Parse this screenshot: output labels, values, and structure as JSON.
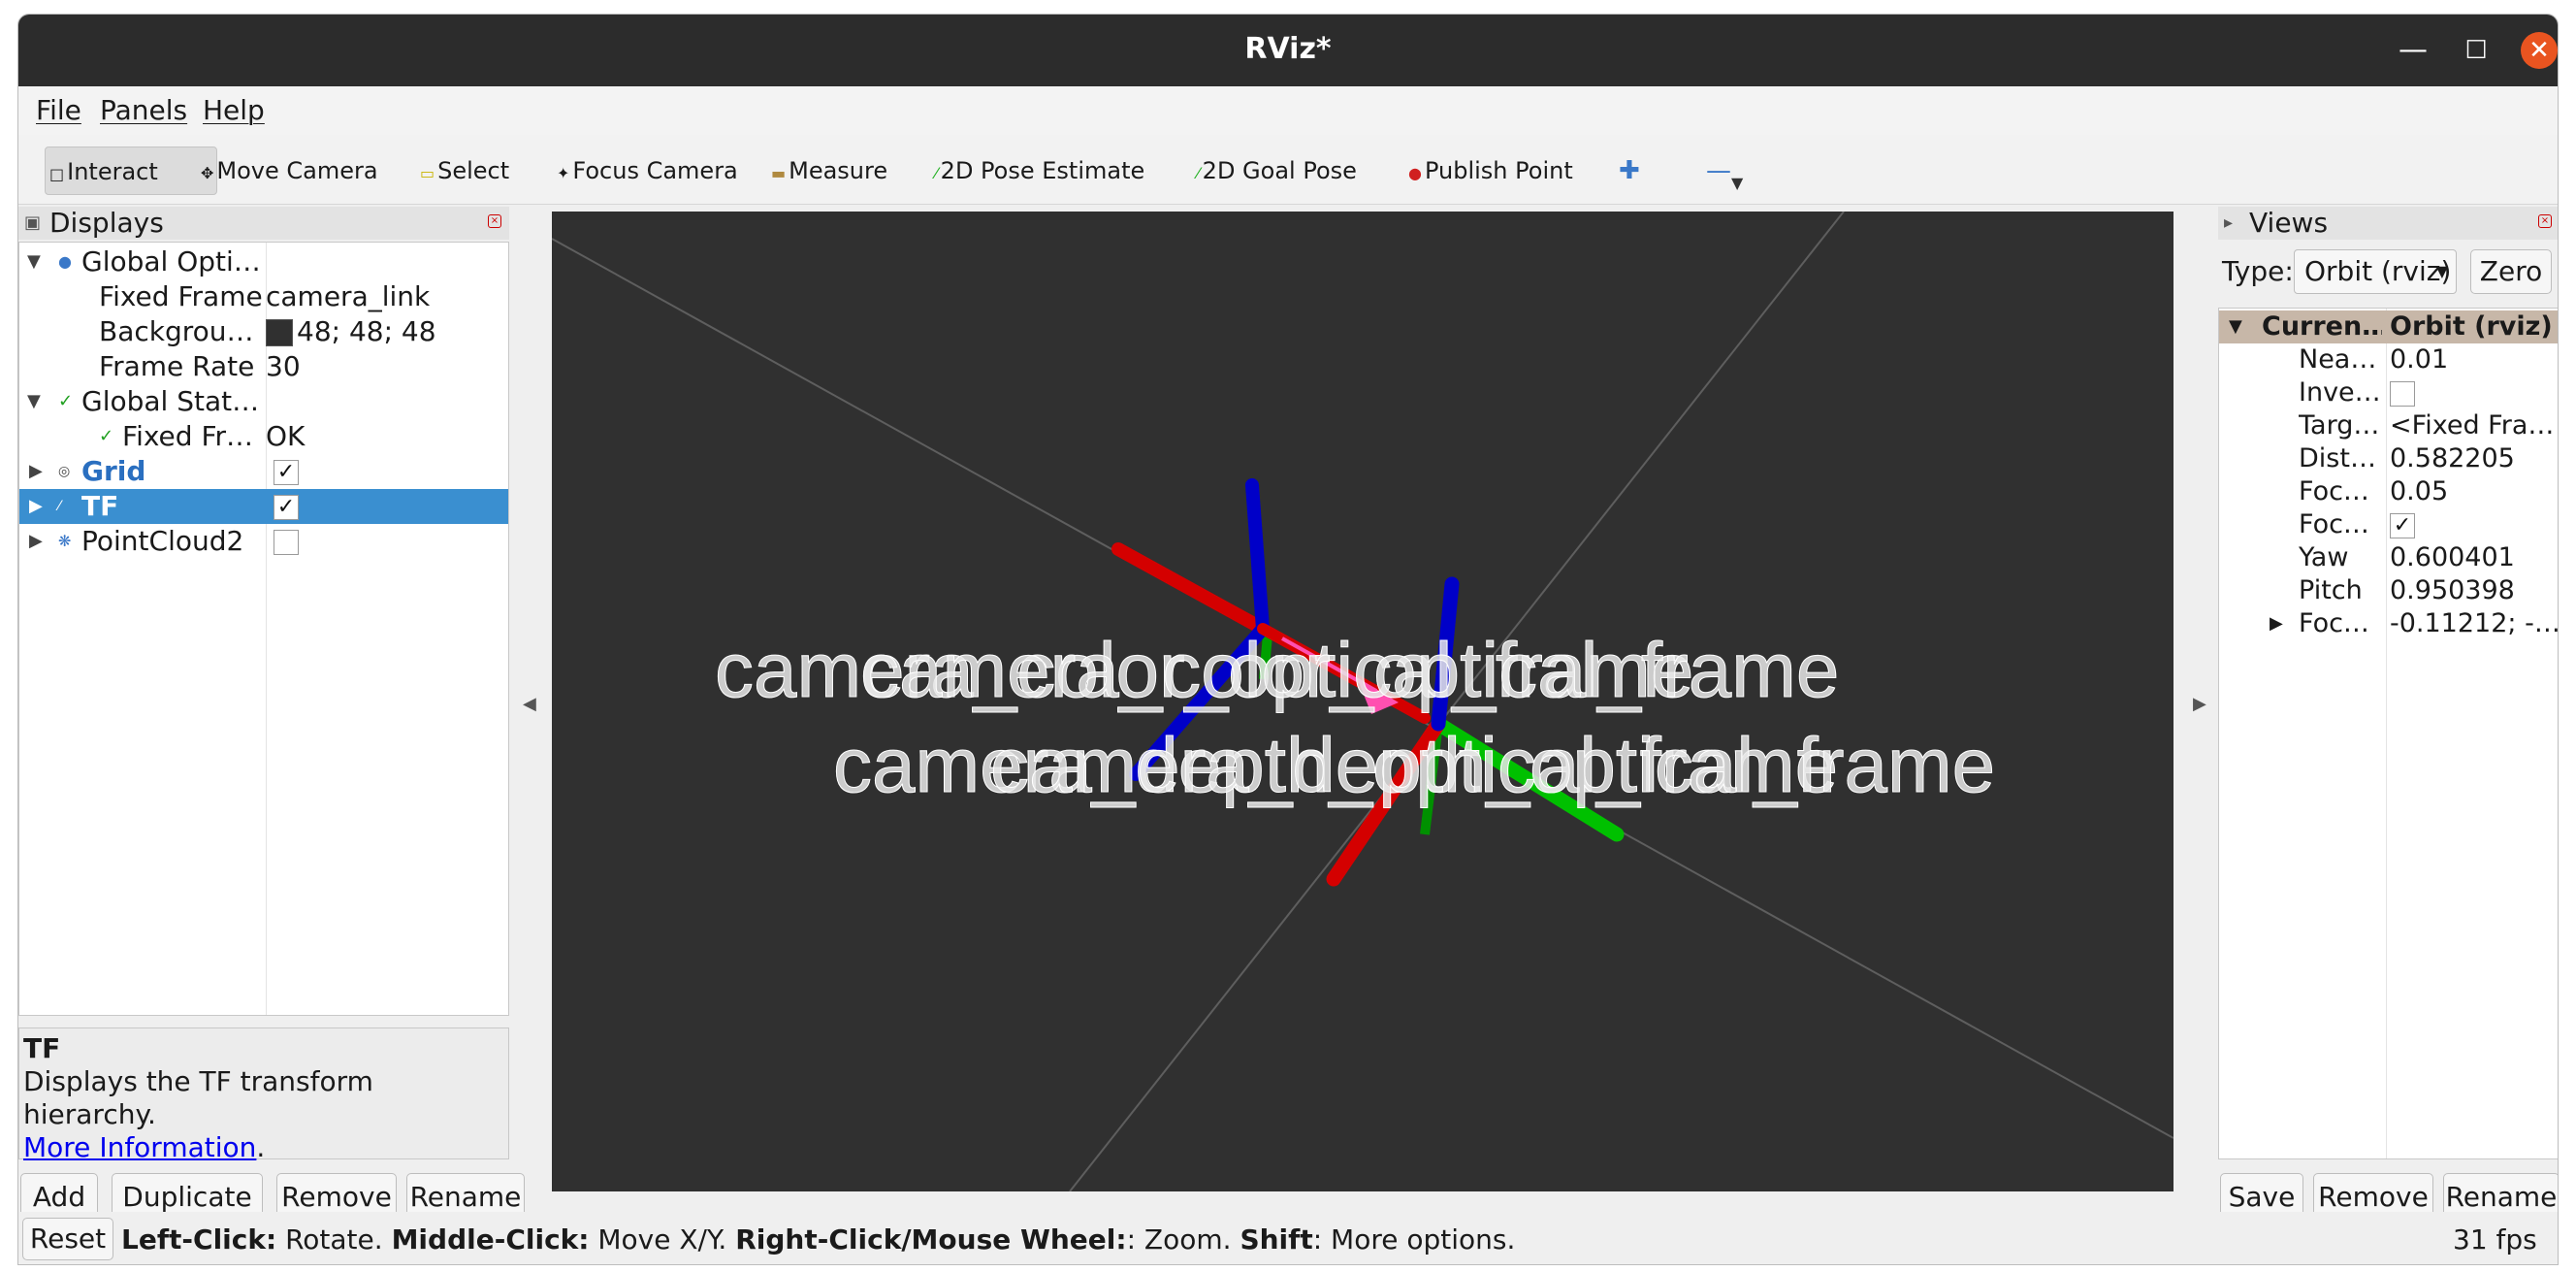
{
  "window": {
    "title": "RViz*"
  },
  "menu": {
    "file": "File",
    "panels": "Panels",
    "help": "Help"
  },
  "toolbar": {
    "interact": "Interact",
    "move_camera": "Move Camera",
    "select": "Select",
    "focus_camera": "Focus Camera",
    "measure": "Measure",
    "pose_estimate": "2D Pose Estimate",
    "goal_pose": "2D Goal Pose",
    "publish_point": "Publish Point"
  },
  "displays": {
    "title": "Displays",
    "rows": {
      "global_options": "Global Opti…",
      "fixed_frame_key": "Fixed Frame",
      "fixed_frame_val": "camera_link",
      "background_key": "Backgrou…",
      "background_val": "48; 48; 48",
      "frame_rate_key": "Frame Rate",
      "frame_rate_val": "30",
      "global_status": "Global Stat…",
      "fixed_frame_status_key": "Fixed Fr…",
      "fixed_frame_status_val": "OK",
      "grid": "Grid",
      "tf": "TF",
      "pointcloud": "PointCloud2"
    },
    "checks": {
      "grid": true,
      "tf": true,
      "pointcloud": false
    },
    "background_color": "#303030",
    "description": {
      "title": "TF",
      "text": "Displays the TF transform hierarchy.",
      "link": "More Information",
      "suffix": "."
    },
    "buttons": {
      "add": "Add",
      "duplicate": "Duplicate",
      "remove": "Remove",
      "rename": "Rename"
    }
  },
  "viewport": {
    "frame_labels": {
      "row1": "camera_color_optical_frame",
      "row2": "camera_depth_optical_frame"
    },
    "colors": {
      "x_axis": "#d40000",
      "y_axis": "#00c000",
      "z_axis": "#0000c8",
      "arrow": "#ff50b0",
      "background": "#303030"
    }
  },
  "views": {
    "title": "Views",
    "type_label": "Type:",
    "type_value": "Orbit (rviz)",
    "zero": "Zero",
    "header_key": "Curren…",
    "header_val": "Orbit (rviz)",
    "props": [
      {
        "key": "Nea…",
        "val": "0.01"
      },
      {
        "key": "Inve…",
        "val": ""
      },
      {
        "key": "Targ…",
        "val": "<Fixed Fra…"
      },
      {
        "key": "Dist…",
        "val": "0.582205"
      },
      {
        "key": "Foc…",
        "val": "0.05"
      },
      {
        "key": "Foc…",
        "val": ""
      },
      {
        "key": "Yaw",
        "val": "0.600401"
      },
      {
        "key": "Pitch",
        "val": "0.950398"
      },
      {
        "key": "Foc…",
        "val": "-0.11212; -…"
      }
    ],
    "invert_checked": false,
    "focal_shape_checked": true,
    "buttons": {
      "save": "Save",
      "remove": "Remove",
      "rename": "Rename"
    }
  },
  "status": {
    "reset": "Reset",
    "left_click": "Left-Click:",
    "left_click_desc": " Rotate. ",
    "middle_click": "Middle-Click:",
    "middle_click_desc": " Move X/Y. ",
    "right_click": "Right-Click/Mouse Wheel:",
    "right_click_desc": ": Zoom. ",
    "shift": "Shift",
    "shift_desc": ": More options.",
    "fps": "31 fps"
  }
}
